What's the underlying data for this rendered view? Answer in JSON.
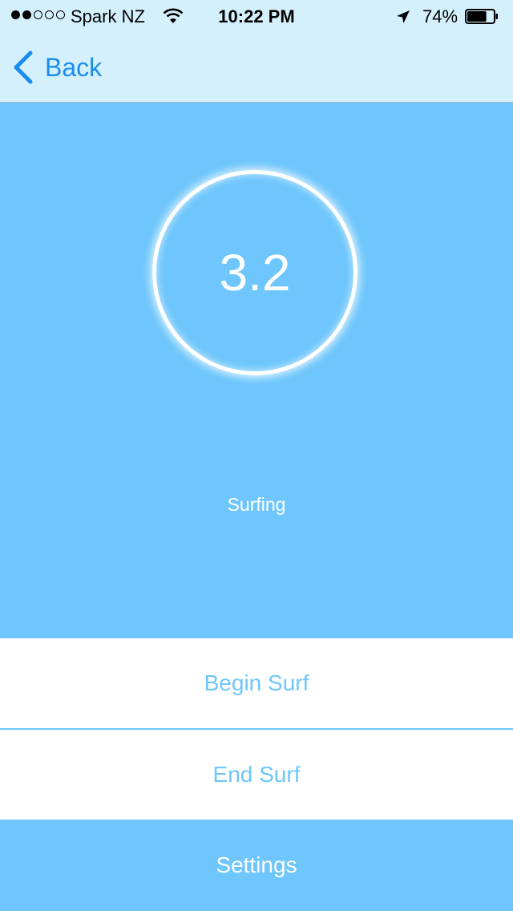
{
  "status_bar": {
    "carrier": "Spark NZ",
    "signal_strength": 2,
    "signal_max": 5,
    "time": "10:22 PM",
    "battery_percent": "74%",
    "battery_level": 0.74,
    "icons": [
      "wifi-icon",
      "location-arrow-icon",
      "battery-icon"
    ]
  },
  "nav": {
    "back_label": "Back",
    "back_icon": "chevron-left-icon"
  },
  "main": {
    "value": "3.2",
    "status": "Surfing"
  },
  "buttons": {
    "begin": "Begin Surf",
    "end": "End Surf",
    "settings": "Settings"
  },
  "colors": {
    "header_bg": "#d4f0fd",
    "accent": "#6ec6fc",
    "link": "#1a8cf0"
  }
}
